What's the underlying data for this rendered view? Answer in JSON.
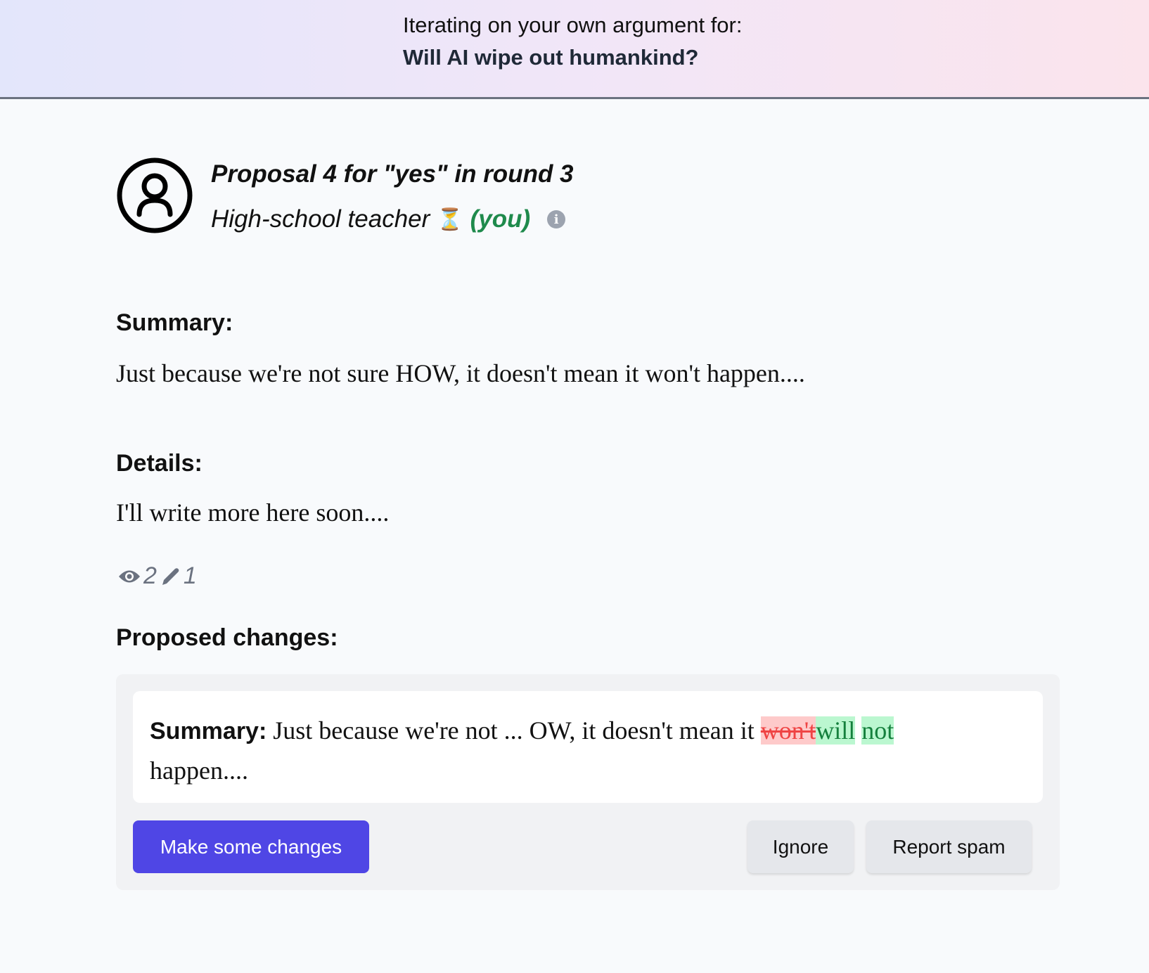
{
  "header": {
    "line1": "Iterating on your own argument for:",
    "question": "Will AI wipe out humankind?"
  },
  "proposal": {
    "title": "Proposal 4 for \"yes\" in round 3",
    "author": "High-school teacher",
    "author_emoji": "⏳",
    "you_label": "(you)",
    "info_icon": "info-icon",
    "avatar_icon": "user-circle-icon"
  },
  "summary": {
    "label": "Summary:",
    "text": "Just because we're not sure HOW, it doesn't mean it won't happen...."
  },
  "details": {
    "label": "Details:",
    "text": "I'll write more here soon...."
  },
  "stats": {
    "views": "2",
    "edits": "1"
  },
  "proposed": {
    "label": "Proposed changes:",
    "field": "Summary:",
    "before": " Just because we're not ... OW, it doesn't mean it ",
    "deleted": "won't",
    "inserted1": "will",
    "inserted2": "not",
    "after": "happen....",
    "colors": {
      "deleted_bg": "#fecaca",
      "inserted_bg": "#bbf7d0"
    }
  },
  "actions": {
    "make_changes": "Make some changes",
    "ignore": "Ignore",
    "report": "Report spam",
    "primary_color": "#4f46e5"
  }
}
